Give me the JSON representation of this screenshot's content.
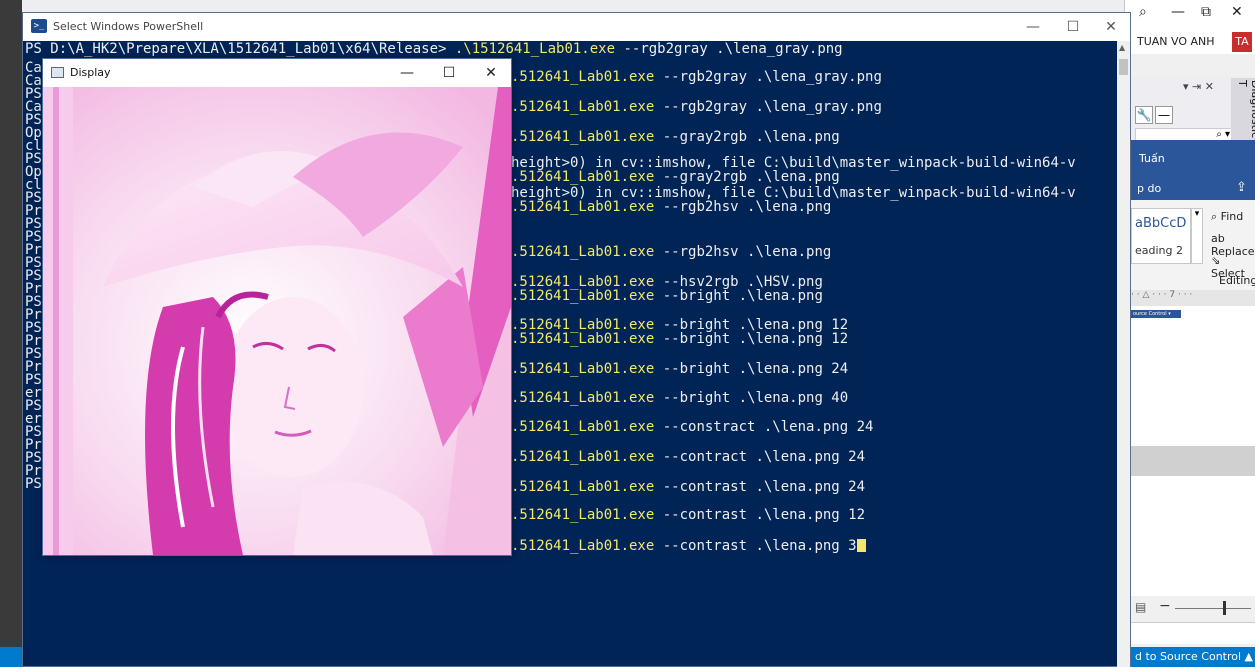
{
  "powershell": {
    "title": "Select Windows PowerShell",
    "window_controls": {
      "minimize": "—",
      "maximize": "☐",
      "close": "✕"
    },
    "hidden_prefixes": [
      "Ca",
      "Ca",
      "PS",
      "Ca",
      "PS",
      "Op",
      "cl",
      "PS",
      "Op",
      "cl",
      "PS",
      "Pr",
      "PS",
      "PS",
      "Pr",
      "PS",
      "PS",
      "Pr",
      "PS",
      "Pr",
      "PS",
      "Pr",
      "PS",
      "Pr",
      "PS",
      "er",
      "PS",
      "er",
      "PS",
      "Pr",
      "PS",
      "Pr",
      "PS"
    ],
    "first_line": {
      "prompt": "PS D:\\A_HK2\\Prepare\\XLA\\1512641_Lab01\\x64\\Release> ",
      "command": ".\\1512641_Lab01.exe",
      "args": " --rgb2gray .\\lena_gray.png"
    },
    "lines": [
      {
        "command": ".512641_Lab01.exe",
        "args": " --rgb2gray .\\lena_gray.png"
      },
      {
        "command": ".512641_Lab01.exe",
        "args": " --rgb2gray .\\lena_gray.png"
      },
      {
        "command": ".512641_Lab01.exe",
        "args": " --gray2rgb .\\lena.png"
      },
      {
        "command": "",
        "args": "height>0) in cv::imshow, file C:\\build\\master_winpack-build-win64-v"
      },
      {
        "command": ".512641_Lab01.exe",
        "args": " --gray2rgb .\\lena.png"
      },
      {
        "command": "",
        "args": "height>0) in cv::imshow, file C:\\build\\master_winpack-build-win64-v"
      },
      {
        "command": ".512641_Lab01.exe",
        "args": " --rgb2hsv .\\lena.png"
      },
      {
        "command": ".512641_Lab01.exe",
        "args": " --rgb2hsv .\\lena.png"
      },
      {
        "command": ".512641_Lab01.exe",
        "args": " --hsv2rgb .\\HSV.png"
      },
      {
        "command": ".512641_Lab01.exe",
        "args": " --bright .\\lena.png"
      },
      {
        "command": ".512641_Lab01.exe",
        "args": " --bright .\\lena.png 12"
      },
      {
        "command": ".512641_Lab01.exe",
        "args": " --bright .\\lena.png 12"
      },
      {
        "command": ".512641_Lab01.exe",
        "args": " --bright .\\lena.png 24"
      },
      {
        "command": ".512641_Lab01.exe",
        "args": " --bright .\\lena.png 40"
      },
      {
        "command": ".512641_Lab01.exe",
        "args": " --constract .\\lena.png 24"
      },
      {
        "command": ".512641_Lab01.exe",
        "args": " --contract .\\lena.png 24"
      },
      {
        "command": ".512641_Lab01.exe",
        "args": " --contrast .\\lena.png 24"
      },
      {
        "command": ".512641_Lab01.exe",
        "args": " --contrast .\\lena.png 12"
      },
      {
        "command": ".512641_Lab01.exe",
        "args": " --contrast .\\lena.png 3"
      }
    ]
  },
  "display": {
    "title": "Display",
    "window_controls": {
      "minimize": "—",
      "maximize": "☐",
      "close": "✕"
    }
  },
  "right_app": {
    "account_name": "TUAN VO ANH",
    "account_initials": "TA",
    "window_controls": {
      "search": "⌕",
      "minimize": "—",
      "restore": "⧉",
      "close": "✕"
    },
    "pin_controls": "▾ ⇥ ✕",
    "diagnostic_tab": "Diagnostic T",
    "search_icon_text": "⌕ ▾",
    "word_user": "Tuấn",
    "tell_me": "p do",
    "styles": {
      "heading": "aBbCcD",
      "name": "eading 2"
    },
    "editing": {
      "find": "Find",
      "replace": "Replace",
      "select": "Select",
      "group": "Editing"
    },
    "ruler": "· · △ · · · 7 · · ·",
    "source_tag": "ource Control ▾",
    "status": "d to Source Control ▲"
  },
  "colors": {
    "console_bg": "#012456",
    "console_text": "#eeedf0",
    "command_yellow": "#f2e86a",
    "vs_blue": "#007acc",
    "word_blue": "#2b579a"
  }
}
